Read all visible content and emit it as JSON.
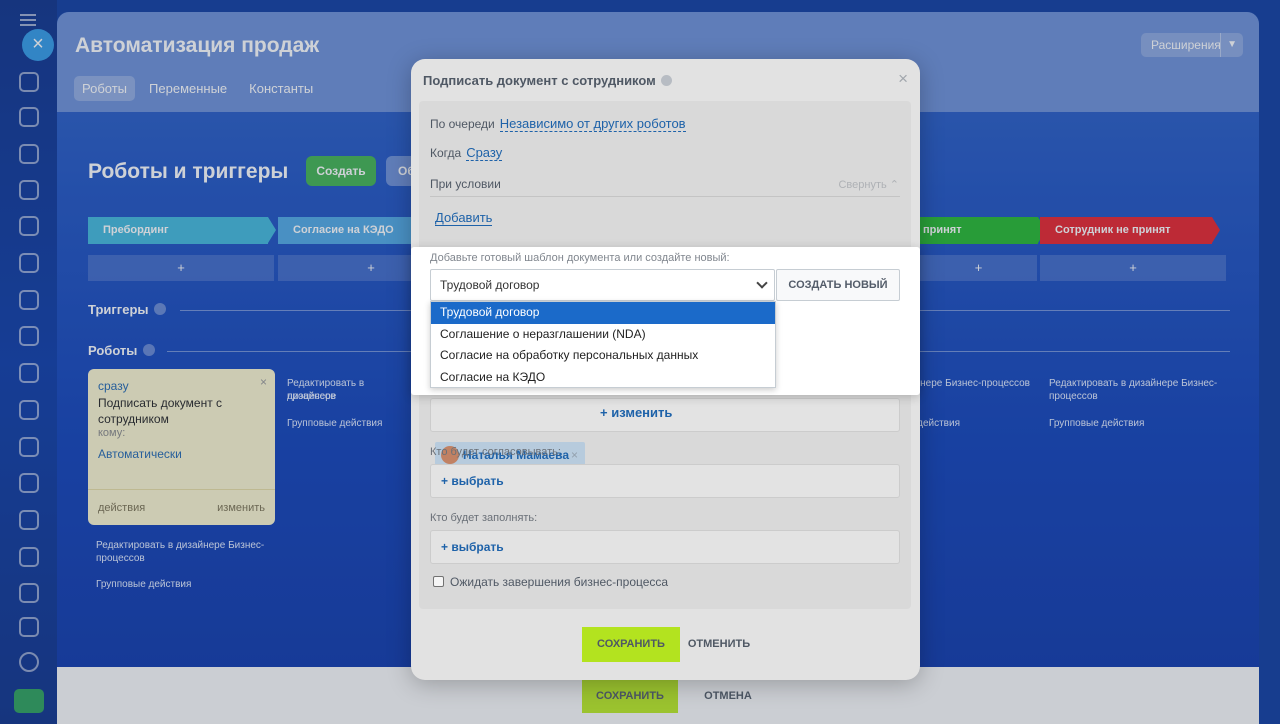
{
  "window": {
    "title": "Автоматизация продаж",
    "extensions_label": "Расширения",
    "tabs": [
      {
        "label": "Роботы",
        "active": true
      },
      {
        "label": "Переменные",
        "active": false
      },
      {
        "label": "Константы",
        "active": false
      }
    ]
  },
  "section": {
    "title": "Роботы и триггеры",
    "create_label": "Создать",
    "about_label": "Об"
  },
  "stages": [
    {
      "label": "Пребординг",
      "color": "#3fb8dd"
    },
    {
      "label": "Согласие на КЭДО",
      "color": "#4ea9e6"
    },
    {
      "label": "принят",
      "color": "#22b92c"
    },
    {
      "label": "Сотрудник не принят",
      "color": "#e8202a"
    }
  ],
  "plus": "+",
  "triggers_label": "Триггеры",
  "robots_label": "Роботы",
  "robot_card": {
    "when": "сразу",
    "title": "Подписать документ с сотрудником",
    "to_label": "кому:",
    "to_value": "Автоматически",
    "actions_label": "действия",
    "change_label": "изменить",
    "close": "×"
  },
  "column_links": {
    "edit": "Редактировать в дизайнере Бизнес-процессов",
    "group": "Групповые действия",
    "edit_short": "Редактировать в дизайнере",
    "edit_tail": "процессов"
  },
  "bottom_bar": {
    "save": "СОХРАНИТЬ",
    "cancel": "ОТМЕНА"
  },
  "modal": {
    "title": "Подписать документ с сотрудником",
    "close": "×",
    "order_label": "По очереди",
    "order_value": "Независимо от других роботов",
    "when_label": "Когда",
    "when_value": "Сразу",
    "condition_label": "При условии",
    "collapse_label": "Свернуть",
    "add_label": "Добавить",
    "person": "Наталья Мамаева",
    "person_remove": "×",
    "change_label": "+ изменить",
    "approvers_label": "Кто будет согласовывать:",
    "approvers_action": "+ выбрать",
    "fillers_label": "Кто будет заполнять:",
    "fillers_action": "+ выбрать",
    "wait_label": "Ожидать завершения бизнес-процесса",
    "save": "СОХРАНИТЬ",
    "cancel": "ОТМЕНИТЬ"
  },
  "template_popup": {
    "label": "Добавьте готовый шаблон документа или создайте новый:",
    "selected": "Трудовой договор",
    "create_new": "СОЗДАТЬ НОВЫЙ",
    "options": [
      "Трудовой договор",
      "Соглашение о неразглашении (NDA)",
      "Согласие на обработку персональных данных",
      "Согласие на КЭДО"
    ],
    "selected_index": 0
  },
  "colors": {
    "accent_link": "#2067b0",
    "save_button": "#bbed21",
    "create_button": "#3fb34f",
    "selected_option": "#1b6ac9"
  }
}
